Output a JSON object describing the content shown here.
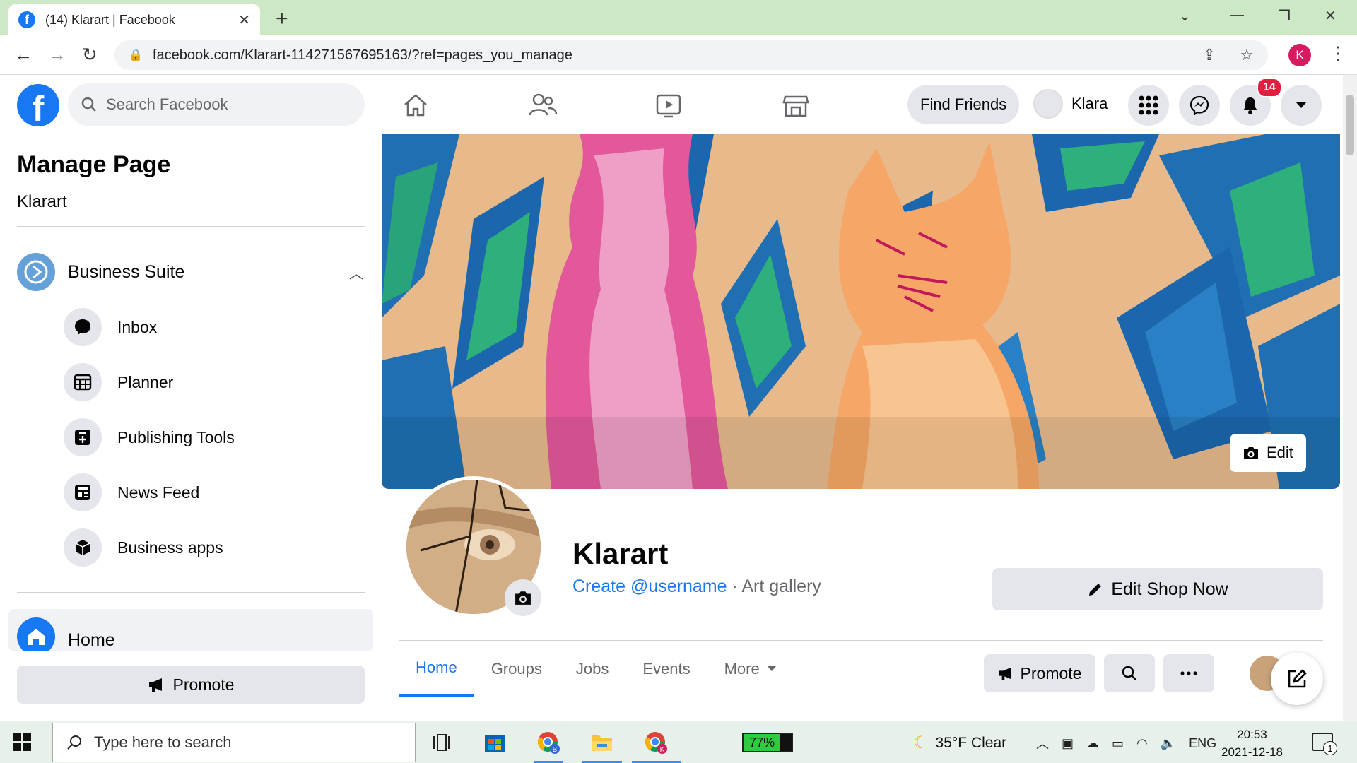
{
  "browser": {
    "tab_title": "(14) Klarart | Facebook",
    "url": "facebook.com/Klarart-114271567695163/?ref=pages_you_manage",
    "profile_initial": "K"
  },
  "header": {
    "search_placeholder": "Search Facebook",
    "find_friends": "Find Friends",
    "user_name": "Klara",
    "notification_count": "14"
  },
  "sidebar": {
    "title": "Manage Page",
    "page_name": "Klarart",
    "business_suite": "Business Suite",
    "items": [
      {
        "label": "Inbox"
      },
      {
        "label": "Planner"
      },
      {
        "label": "Publishing Tools"
      },
      {
        "label": "News Feed"
      },
      {
        "label": "Business apps"
      }
    ],
    "home": "Home",
    "promote": "Promote"
  },
  "profile": {
    "name": "Klarart",
    "username_link": "Create @username",
    "category": " · Art gallery",
    "edit_cover": "Edit",
    "edit_shop": "Edit Shop Now",
    "tabs": [
      {
        "label": "Home"
      },
      {
        "label": "Groups"
      },
      {
        "label": "Jobs"
      },
      {
        "label": "Events"
      },
      {
        "label": "More"
      }
    ],
    "promote": "Promote"
  },
  "taskbar": {
    "search_placeholder": "Type here to search",
    "battery": "77%",
    "battery_level": 0.77,
    "weather": "35°F  Clear",
    "lang": "ENG",
    "time": "20:53",
    "date": "2021-12-18",
    "notification_count": "1"
  },
  "colors": {
    "accent": "#1877f2",
    "badge": "#e41e3f",
    "tabbar": "#cce8c4"
  }
}
